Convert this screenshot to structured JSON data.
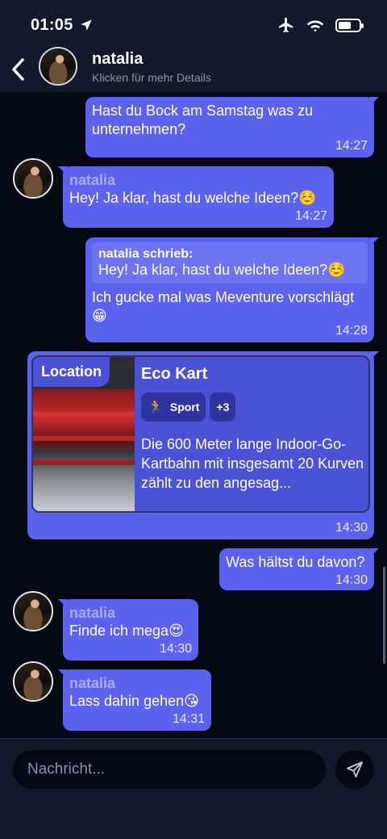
{
  "status": {
    "time": "01:05"
  },
  "header": {
    "name": "natalia",
    "subtitle": "Klicken für mehr Details"
  },
  "messages": {
    "m1": {
      "text": "Hast du Bock am Samstag was zu unternehmen?",
      "time": "14:27"
    },
    "m2": {
      "sender": "natalia",
      "text": "Hey! Ja klar, hast du welche Ideen?☺️",
      "time": "14:27"
    },
    "m3": {
      "quote_header": "natalia schrieb:",
      "quote_text": "Hey! Ja klar, hast du welche Ideen?☺️",
      "text": "Ich gucke mal was Meventure vorschlägt 😁",
      "time": "14:28"
    },
    "m4": {
      "badge": "Location",
      "title": "Eco Kart",
      "tag1_label": "Sport",
      "tag2_label": "+3",
      "description": "Die 600 Meter lange Indoor-Go-Kartbahn mit insgesamt 20 Kurven zählt zu den angesag...",
      "time": "14:30"
    },
    "m5": {
      "text": "Was hältst du davon?",
      "time": "14:30"
    },
    "m6": {
      "sender": "natalia",
      "text": "Finde ich mega😍",
      "time": "14:30"
    },
    "m7": {
      "sender": "natalia",
      "text": "Lass dahin gehen😘",
      "time": "14:31"
    }
  },
  "composer": {
    "placeholder": "Nachricht..."
  }
}
